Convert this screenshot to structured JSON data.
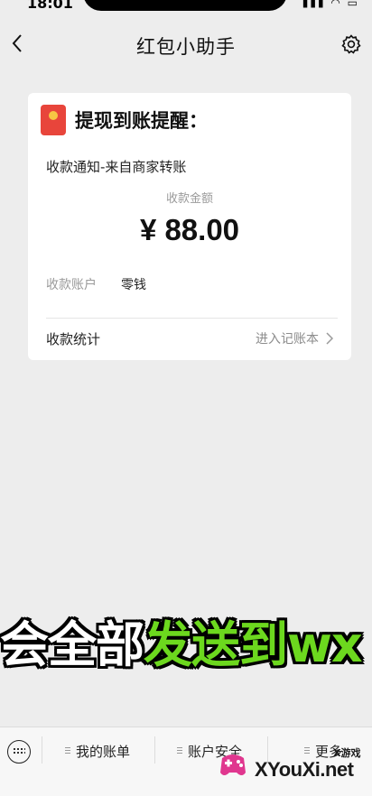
{
  "status_bar": {
    "time": "18:01"
  },
  "nav": {
    "title": "红包小助手"
  },
  "card": {
    "title": "提现到账提醒：",
    "subtitle": "收款通知-来自商家转账",
    "amount_label": "收款金额",
    "amount_value": "¥ 88.00",
    "account_key": "收款账户",
    "account_value": "零钱",
    "stats_label": "收款统计",
    "ledger_link": "进入记账本"
  },
  "banner": {
    "white_text": "会全部",
    "green_text": "发送到wx"
  },
  "bottom_menu": {
    "items": [
      {
        "label": "我的账单"
      },
      {
        "label": "账户安全"
      },
      {
        "label": "更多"
      }
    ]
  },
  "watermark": {
    "small": "X游戏",
    "big": "XYouXi.net"
  },
  "icons": {
    "back": "chevron-left-icon",
    "settings": "gear-icon",
    "card": "red-packet-icon",
    "ledger": "chevron-right-icon",
    "keyboard": "keyboard-icon"
  },
  "colors": {
    "background": "#ededed",
    "card": "#ffffff",
    "red_packet": "#e8453b",
    "banner_green": "#6cd81e"
  }
}
